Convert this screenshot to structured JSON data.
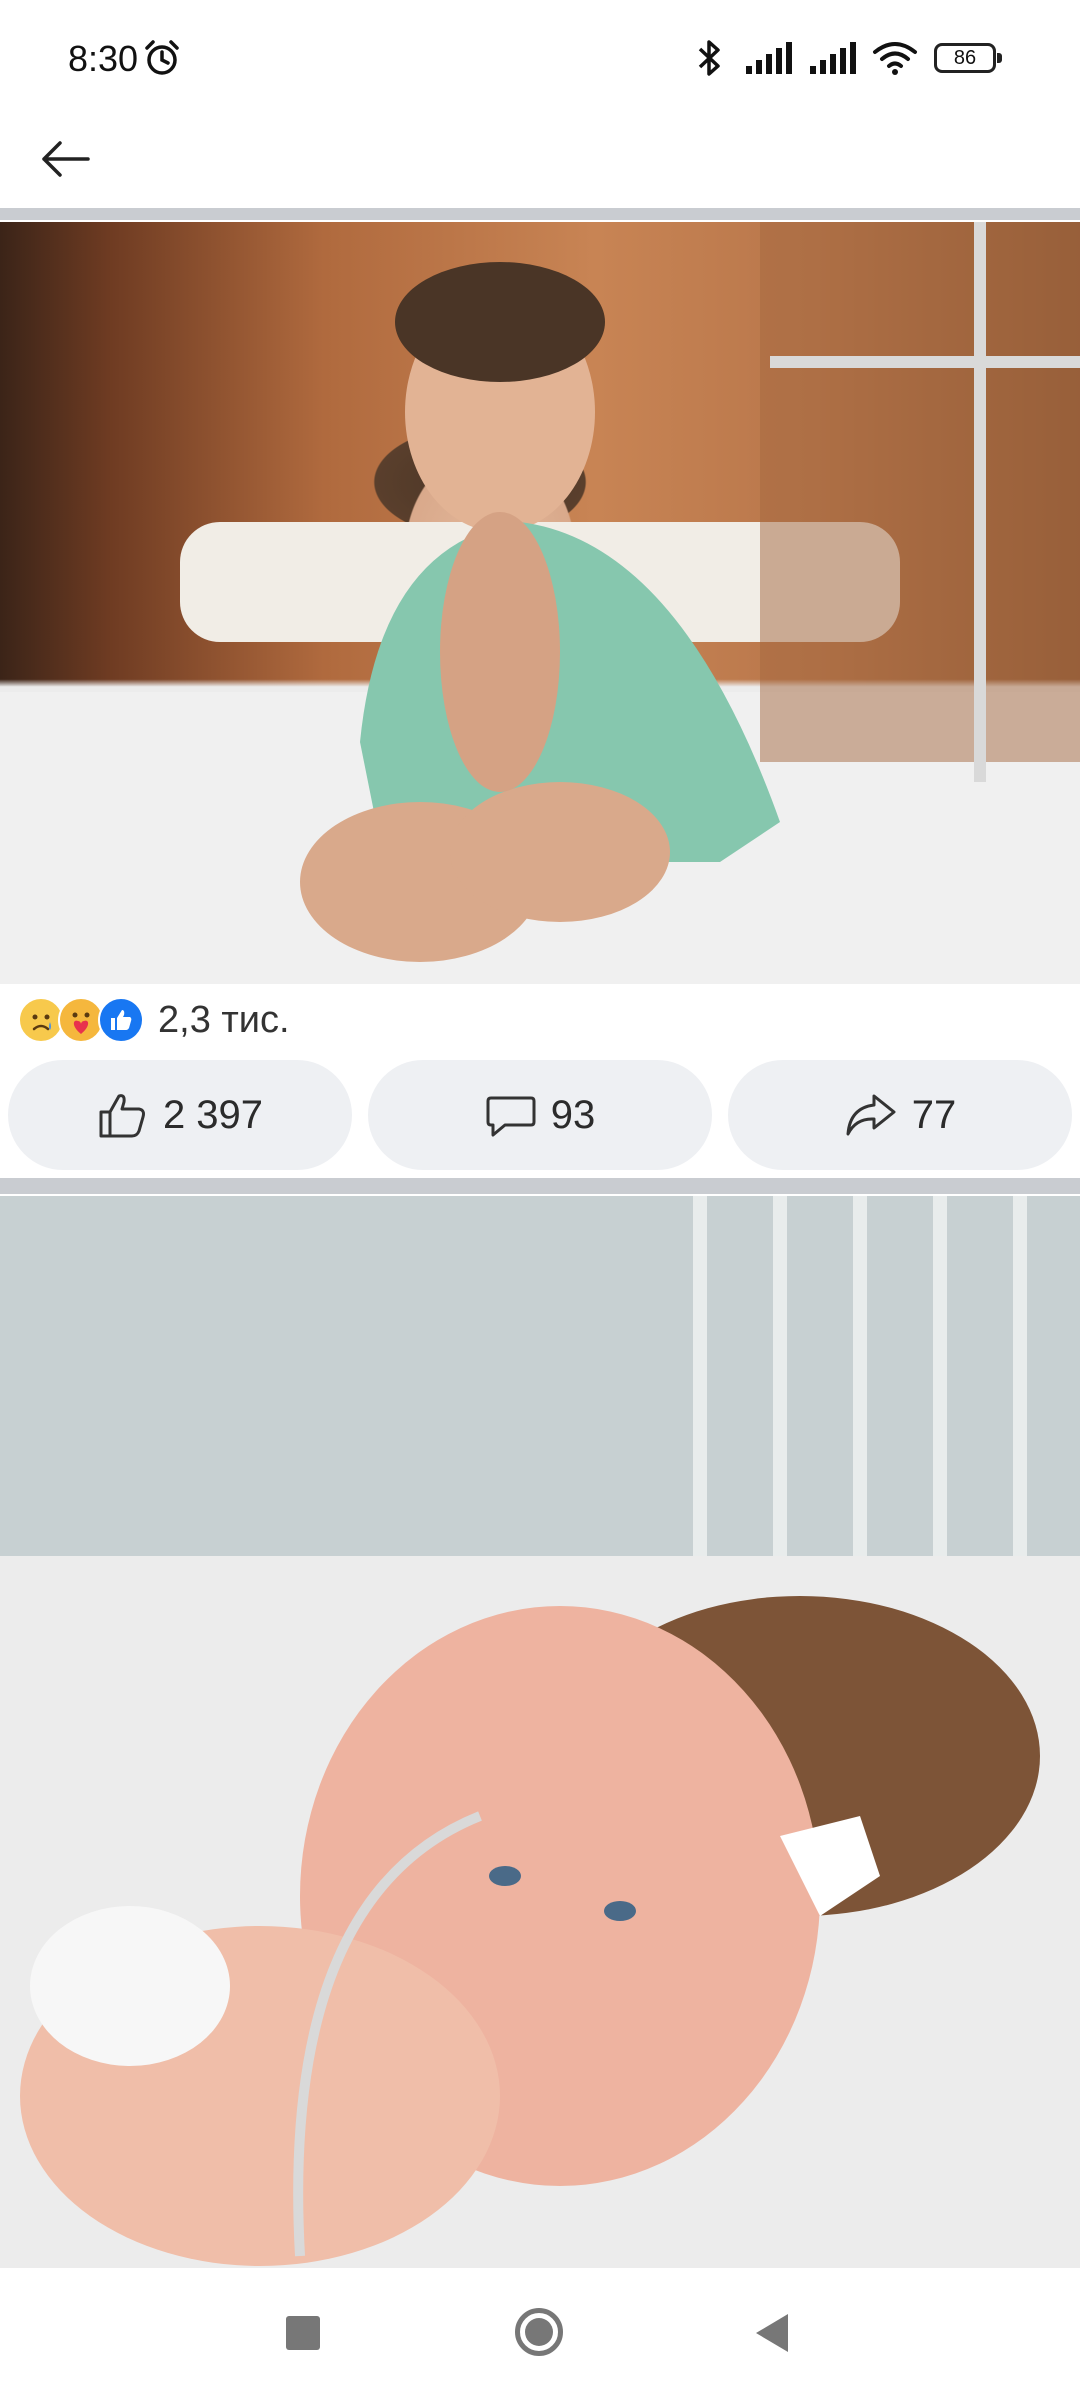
{
  "status_bar": {
    "time": "8:30",
    "battery": "86",
    "icons": [
      "alarm-icon",
      "bluetooth-icon",
      "signal-icon",
      "signal-icon",
      "wifi-icon",
      "battery-icon"
    ]
  },
  "header": {
    "back_icon": "arrow-left-icon"
  },
  "posts": [
    {
      "photo": "hospital-child-photo",
      "reactions": {
        "icons": [
          "sad-icon",
          "care-icon",
          "like-icon"
        ],
        "count": "2,3 тис."
      },
      "actions": {
        "like_count": "2 397",
        "comment_count": "93",
        "share_count": "77"
      }
    },
    {
      "photo": "hospital-toddler-photo"
    }
  ],
  "nav_bar": {
    "icons": [
      "recents-icon",
      "home-icon",
      "back-icon"
    ]
  },
  "colors": {
    "action_bg": "#eef0f3",
    "divider": "#c9ccd1",
    "like_blue": "#1877f2",
    "reaction_yellow": "#f7c94c"
  }
}
